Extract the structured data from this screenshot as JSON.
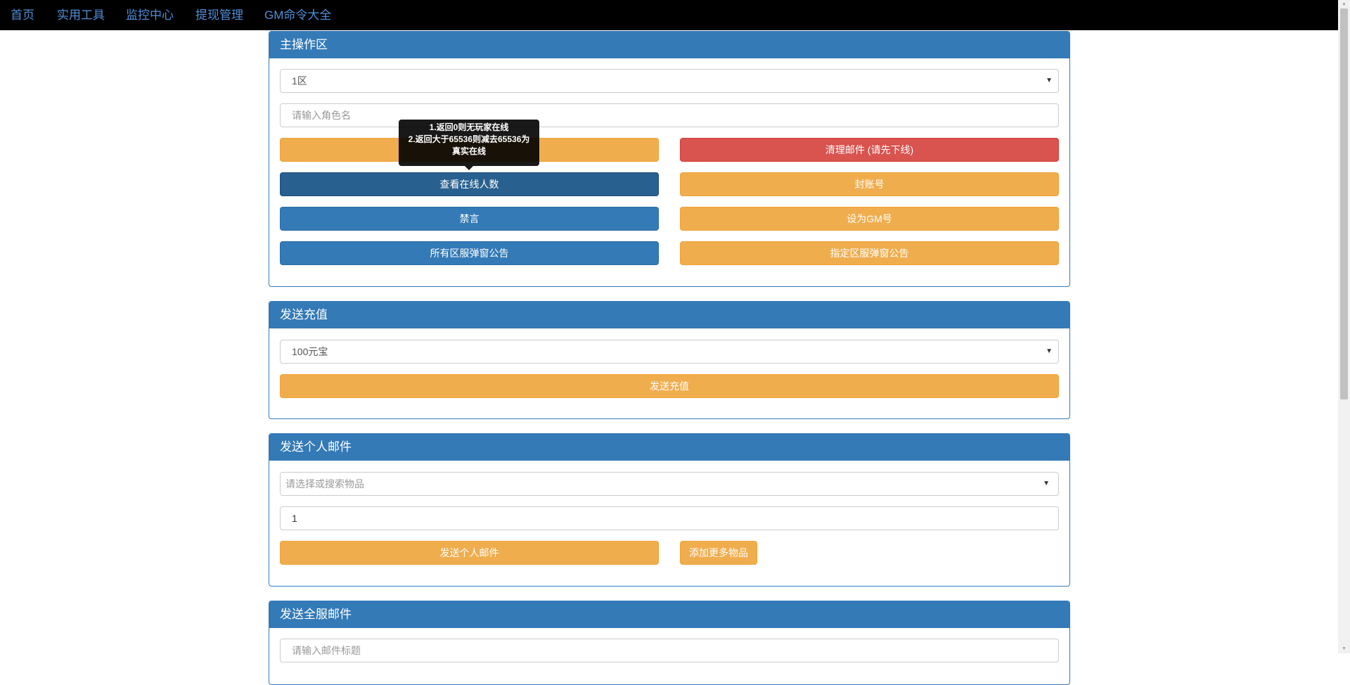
{
  "nav": {
    "items": [
      "首页",
      "实用工具",
      "监控中心",
      "提现管理",
      "GM命令大全"
    ]
  },
  "main_panel": {
    "title": "主操作区",
    "server_select": "1区",
    "role_name_placeholder": "请输入角色名",
    "buttons": {
      "hidden_left": "",
      "clear_mail": "清理邮件 (请先下线)",
      "check_online": "查看在线人数",
      "ban_account": "封账号",
      "mute": "禁言",
      "set_gm": "设为GM号",
      "all_popup": "所有区服弹窗公告",
      "specific_popup": "指定区服弹窗公告"
    },
    "tooltip": [
      "1.返回0则无玩家在线",
      "2.返回大于65536则减去65536为",
      "真实在线"
    ]
  },
  "recharge_panel": {
    "title": "发送充值",
    "amount_select": "100元宝",
    "send_button": "发送充值"
  },
  "personal_mail_panel": {
    "title": "发送个人邮件",
    "item_select_placeholder": "请选择或搜索物品",
    "quantity_value": "1",
    "send_button": "发送个人邮件",
    "add_more_button": "添加更多物品"
  },
  "server_mail_panel": {
    "title": "发送全服邮件",
    "mail_title_placeholder": "请输入邮件标题"
  },
  "colors": {
    "primary": "#337ab7",
    "warning": "#f0ad4e",
    "danger": "#d9534f",
    "nav_bg": "#000000",
    "nav_link": "#4f8ed8"
  }
}
